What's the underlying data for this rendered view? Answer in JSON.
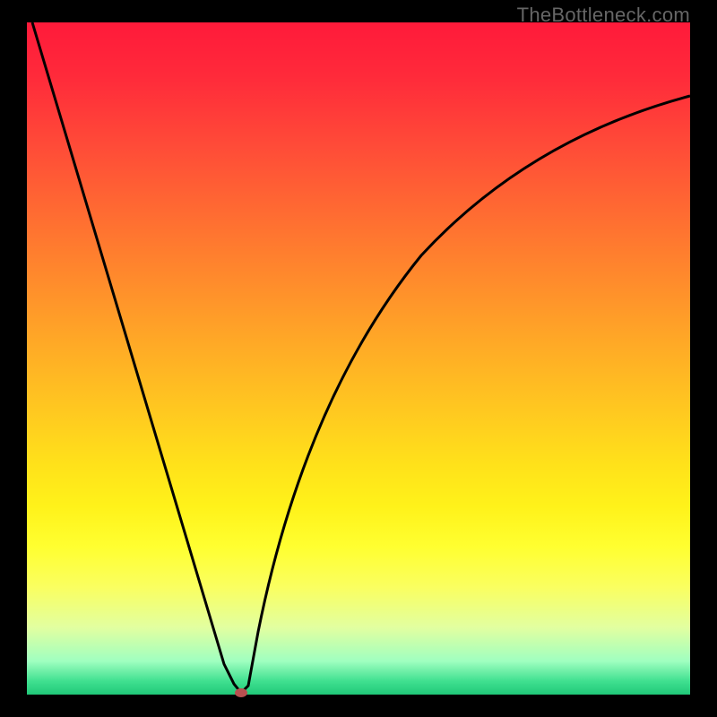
{
  "watermark": "TheBottleneck.com",
  "chart_data": {
    "type": "line",
    "title": "",
    "xlabel": "",
    "ylabel": "",
    "xlim": [
      0,
      100
    ],
    "ylim": [
      0,
      100
    ],
    "background": "rainbow-vertical",
    "series": [
      {
        "name": "bottleneck-curve",
        "x": [
          0,
          5,
          10,
          15,
          20,
          25,
          28,
          30,
          31,
          32,
          35,
          40,
          45,
          50,
          55,
          60,
          65,
          70,
          75,
          80,
          85,
          90,
          95,
          100
        ],
        "y": [
          100,
          84,
          68,
          52,
          36,
          20,
          10,
          4,
          1,
          0,
          10,
          24,
          36,
          46,
          54,
          61,
          67,
          72,
          76,
          79.5,
          82.5,
          85,
          87,
          89
        ]
      }
    ],
    "marker": {
      "x": 32,
      "y": 0,
      "color": "#b85050",
      "shape": "ellipse"
    }
  }
}
